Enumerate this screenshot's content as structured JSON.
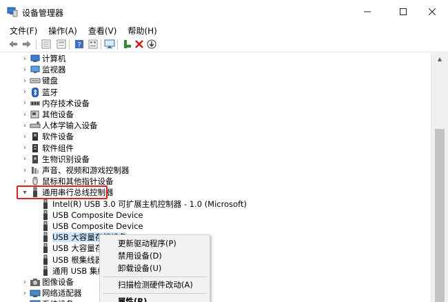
{
  "window": {
    "title": "设备管理器",
    "minimize_glyph": "—",
    "maximize_glyph": "☐",
    "close_glyph": "✕"
  },
  "menubar": {
    "items": [
      {
        "label": "文件(F)"
      },
      {
        "label": "操作(A)"
      },
      {
        "label": "查看(V)"
      },
      {
        "label": "帮助(H)"
      }
    ]
  },
  "toolbar": {
    "buttons": [
      "back-icon",
      "forward-icon",
      "properties-icon",
      "view-icon",
      "help-icon",
      "device-view-icon",
      "monitor-icon",
      "add-driver-icon",
      "uninstall-icon",
      "update-icon"
    ]
  },
  "tree": {
    "categories_top": [
      {
        "label": "计算机",
        "icon": "computer-icon"
      },
      {
        "label": "监视器",
        "icon": "monitor-icon"
      },
      {
        "label": "键盘",
        "icon": "keyboard-icon"
      },
      {
        "label": "蓝牙",
        "icon": "bluetooth-icon"
      },
      {
        "label": "内存技术设备",
        "icon": "memory-icon"
      },
      {
        "label": "其他设备",
        "icon": "unknown-device-icon"
      },
      {
        "label": "人体学输入设备",
        "icon": "hid-icon"
      },
      {
        "label": "软件设备",
        "icon": "software-device-icon"
      },
      {
        "label": "软件组件",
        "icon": "software-component-icon"
      },
      {
        "label": "生物识别设备",
        "icon": "biometric-icon"
      },
      {
        "label": "声音、视频和游戏控制器",
        "icon": "audio-icon"
      },
      {
        "label": "鼠标和其他指针设备",
        "icon": "mouse-icon"
      }
    ],
    "usb_category": {
      "label": "通用串行总线控制器",
      "icon": "usb-icon"
    },
    "usb_children": [
      {
        "label": "Intel(R) USB 3.0 可扩展主机控制器 - 1.0 (Microsoft)"
      },
      {
        "label": "USB Composite Device"
      },
      {
        "label": "USB Composite Device"
      },
      {
        "label": "USB 大容量存储设备"
      },
      {
        "label": "USB 大容量存储"
      },
      {
        "label": "USB 根集线器("
      },
      {
        "label": "通用 USB 集线"
      }
    ],
    "categories_bottom": [
      {
        "label": "图像设备",
        "icon": "camera-icon"
      },
      {
        "label": "网络适配器",
        "icon": "network-icon"
      },
      {
        "label": "系统设备",
        "icon": "system-icon"
      }
    ]
  },
  "context_menu": {
    "items": [
      {
        "label": "更新驱动程序(P)"
      },
      {
        "label": "禁用设备(D)"
      },
      {
        "label": "卸载设备(U)"
      },
      {
        "label": "扫描检测硬件改动(A)"
      },
      {
        "label": "属性(R)"
      }
    ]
  },
  "colors": {
    "highlight_red": "#e02020",
    "selection": "#cce8ff"
  }
}
